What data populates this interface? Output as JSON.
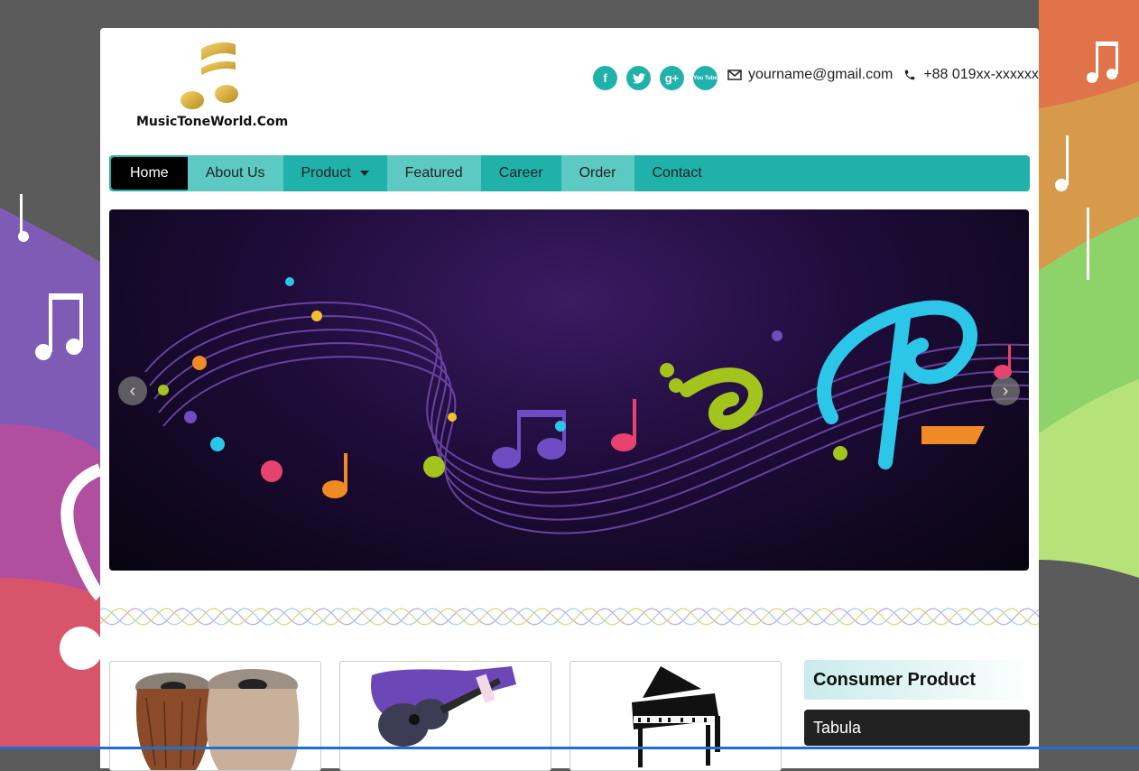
{
  "site": {
    "logo_text": "MusicToneWorld.Com",
    "logo_badge": "Music Tone World"
  },
  "header": {
    "social": [
      {
        "icon": "facebook-icon",
        "glyph": "f"
      },
      {
        "icon": "twitter-icon",
        "glyph": "t"
      },
      {
        "icon": "google-plus-icon",
        "glyph": "g+"
      },
      {
        "icon": "youtube-icon",
        "glyph": "You Tube"
      }
    ],
    "email": "yourname@gmail.com",
    "phone": "+88 019xx-xxxxxx"
  },
  "nav": {
    "items": [
      {
        "label": "Home"
      },
      {
        "label": "About Us"
      },
      {
        "label": "Product"
      },
      {
        "label": "Featured"
      },
      {
        "label": "Career"
      },
      {
        "label": "Order"
      },
      {
        "label": "Contact"
      }
    ]
  },
  "slider": {
    "prev_glyph": "‹",
    "next_glyph": "›"
  },
  "sidebar": {
    "heading": "Consumer Product",
    "items": [
      {
        "label": "Tabula"
      }
    ]
  },
  "colors": {
    "accent": "#20b2aa",
    "accent_light": "#5cc9c3",
    "nav_active": "#000000"
  }
}
